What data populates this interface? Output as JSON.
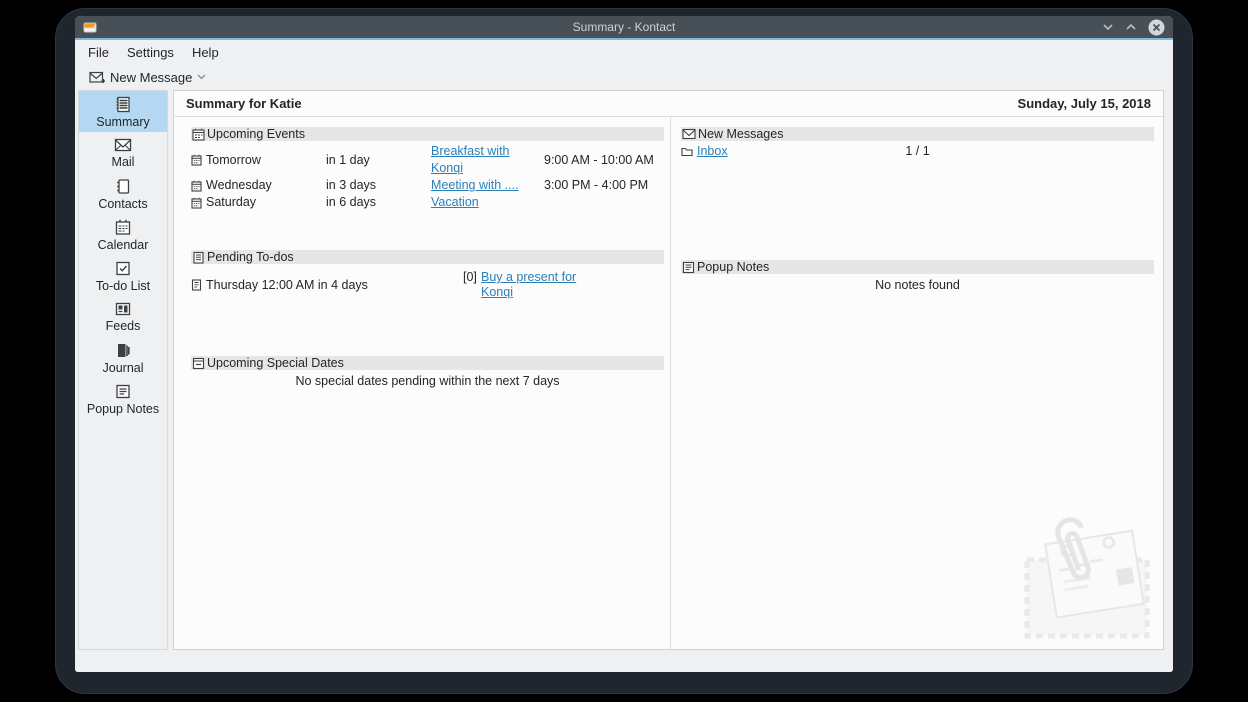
{
  "window": {
    "title": "Summary - Kontact"
  },
  "menubar": {
    "items": {
      "file": "File",
      "settings": "Settings",
      "help": "Help"
    }
  },
  "toolbar": {
    "new_message_label": "New Message"
  },
  "sidebar": {
    "items": [
      {
        "label": "Summary"
      },
      {
        "label": "Mail"
      },
      {
        "label": "Contacts"
      },
      {
        "label": "Calendar"
      },
      {
        "label": "To-do List"
      },
      {
        "label": "Feeds"
      },
      {
        "label": "Journal"
      },
      {
        "label": "Popup Notes"
      }
    ]
  },
  "header": {
    "title": "Summary for Katie",
    "date": "Sunday, July 15, 2018"
  },
  "sections": {
    "upcoming_events": {
      "title": "Upcoming Events",
      "rows": [
        {
          "day": "Tomorrow",
          "relative": "in 1 day",
          "link": "Breakfast with Konqi",
          "time": "9:00 AM - 10:00 AM"
        },
        {
          "day": "Wednesday",
          "relative": "in 3 days",
          "link": "Meeting with ....",
          "time": "3:00 PM - 4:00 PM"
        },
        {
          "day": "Saturday",
          "relative": "in 6 days",
          "link": "Vacation",
          "time": ""
        }
      ]
    },
    "pending_todos": {
      "title": "Pending To-dos",
      "rows": [
        {
          "when": "Thursday 12:00 AM in 4 days",
          "priority": "[0]",
          "link": "Buy a present for Konqi"
        }
      ]
    },
    "special_dates": {
      "title": "Upcoming Special Dates",
      "empty": "No special dates pending within the next 7 days"
    },
    "new_messages": {
      "title": "New Messages",
      "rows": [
        {
          "folder": "Inbox",
          "count": "1 / 1"
        }
      ]
    },
    "popup_notes": {
      "title": "Popup Notes",
      "empty": "No notes found"
    }
  },
  "colors": {
    "titlebar": "#474f57",
    "accent_line": "#7db8dd",
    "chrome_bg": "#eff0f1",
    "sidebar_selected": "#b5d8f2",
    "panel_bg": "#fcfcfc",
    "section_band": "#e6e6e6",
    "link": "#2980b9",
    "text": "#232629"
  }
}
